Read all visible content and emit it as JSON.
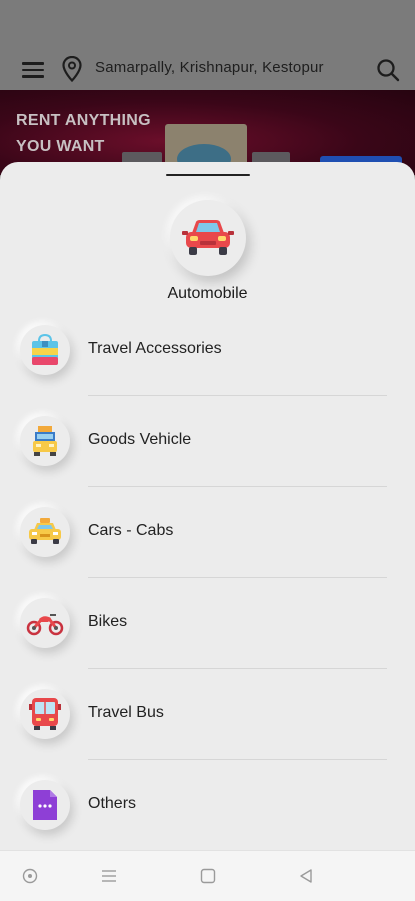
{
  "header": {
    "location": "Samarpally, Krishnapur, Kestopur",
    "icons": [
      "menu-icon",
      "location-pin-icon",
      "search-icon"
    ]
  },
  "banner": {
    "promo_line1": "RENT ANYTHING",
    "promo_line2": "YOU WANT"
  },
  "sheet": {
    "selected_category": {
      "label": "Automobile",
      "icon": "car-icon"
    },
    "subcategories": [
      {
        "label": "Travel Accessories",
        "icon": "travel-bag-icon"
      },
      {
        "label": "Goods Vehicle",
        "icon": "truck-icon"
      },
      {
        "label": "Cars - Cabs",
        "icon": "taxi-icon"
      },
      {
        "label": "Bikes",
        "icon": "motorbike-icon"
      },
      {
        "label": "Travel Bus",
        "icon": "bus-icon"
      },
      {
        "label": "Others",
        "icon": "document-icon"
      }
    ]
  },
  "system_nav": [
    "home-circle-icon",
    "recents-icon",
    "overview-square-icon",
    "back-icon"
  ],
  "colors": {
    "sheet_bg": "#ececec",
    "overlay": "#7b7b7b",
    "banner": "#3a0618"
  }
}
